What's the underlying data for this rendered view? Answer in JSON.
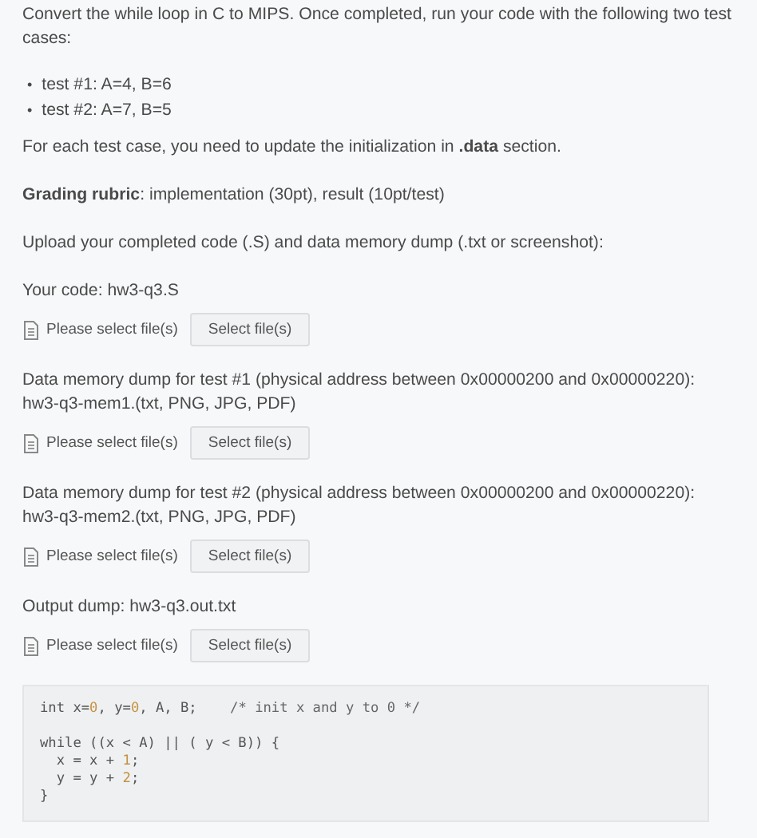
{
  "intro": "Convert the while loop in C to MIPS. Once completed, run your code with the following two test cases:",
  "tests": [
    {
      "bullet": "•",
      "text": "test #1: A=4, B=6"
    },
    {
      "bullet": "•",
      "text": "test #2: A=7, B=5"
    }
  ],
  "note": "For each test case, you need to update the initialization in **.data** section.",
  "rubric": "**Grading rubric**: implementation (30pt), result (10pt/test)",
  "upload_intro": "Upload your completed code (.S) and data memory dump (.txt or screenshot):",
  "uploads": [
    {
      "label": [
        "Your code: hw3-q3.S"
      ],
      "status": "Please select file(s)",
      "button": "Select file(s)"
    },
    {
      "label": [
        "Data memory dump for test #1 (physical address between 0x00000200 and 0x00000220):",
        "hw3-q3-mem1.(txt, PNG, JPG, PDF)"
      ],
      "status": "Please select file(s)",
      "button": "Select file(s)"
    },
    {
      "label": [
        "Data memory dump for test #2 (physical address between 0x00000200 and 0x00000220):",
        "hw3-q3-mem2.(txt, PNG, JPG, PDF)"
      ],
      "status": "Please select file(s)",
      "button": "Select file(s)"
    },
    {
      "label": [
        "Output dump: hw3-q3.out.txt"
      ],
      "status": "Please select file(s)",
      "button": "Select file(s)"
    }
  ],
  "code": [
    [
      [
        {
          "kind": "plain",
          "text": "int x="
        },
        {
          "kind": "number",
          "text": "0"
        },
        {
          "kind": "plain",
          "text": ", y="
        },
        {
          "kind": "number",
          "text": "0"
        },
        {
          "kind": "plain",
          "text": ", A, B;    "
        },
        {
          "kind": "comment",
          "text": "/* init x and y to 0 */"
        }
      ]
    ],
    [
      [
        {
          "kind": "plain",
          "text": "while ((x < A) || ( y < B)) {"
        }
      ],
      [
        {
          "kind": "plain",
          "text": "  x = x + "
        },
        {
          "kind": "number",
          "text": "1"
        },
        {
          "kind": "plain",
          "text": ";"
        }
      ],
      [
        {
          "kind": "plain",
          "text": "  y = y + "
        },
        {
          "kind": "number",
          "text": "2"
        },
        {
          "kind": "plain",
          "text": ";"
        }
      ],
      [
        {
          "kind": "plain",
          "text": "}"
        }
      ]
    ]
  ]
}
